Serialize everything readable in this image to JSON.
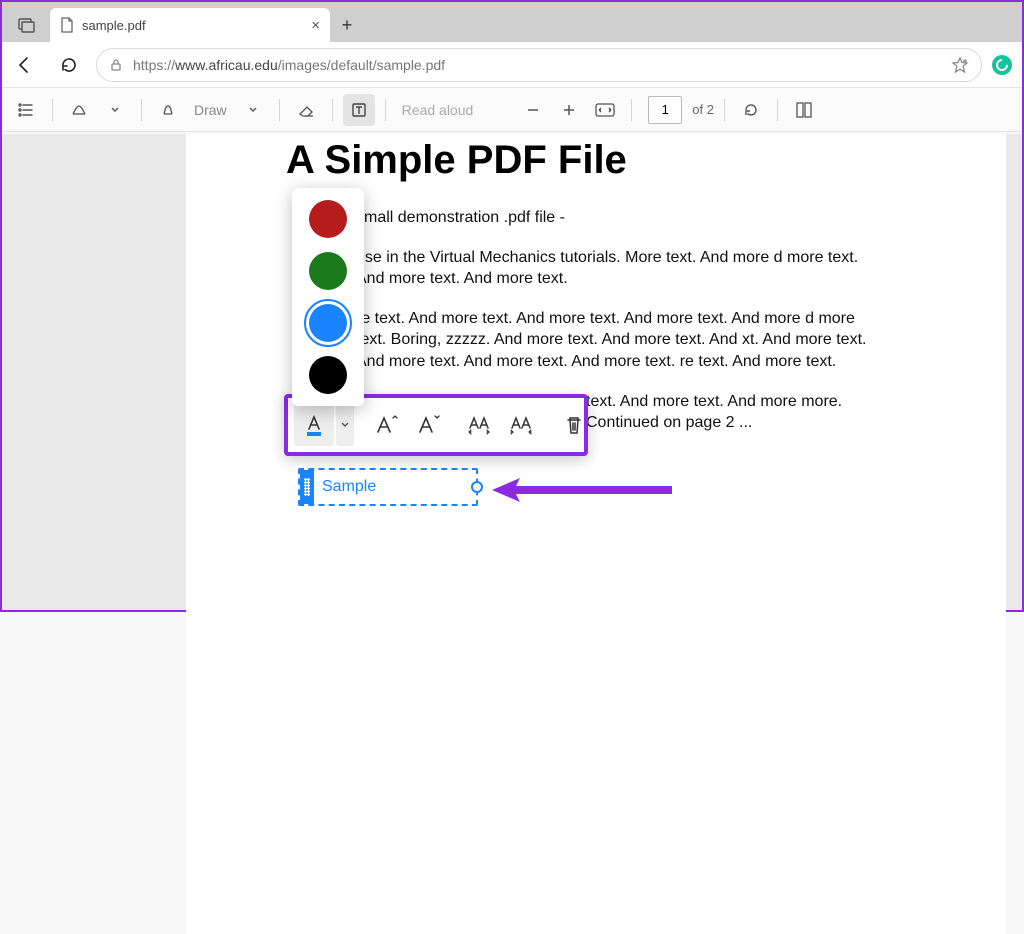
{
  "browser": {
    "tab_title": "sample.pdf",
    "url_display_prefix": "https://",
    "url_display_host": "www.africau.edu",
    "url_display_path": "/images/default/sample.pdf"
  },
  "pdf_toolbar": {
    "draw_label": "Draw",
    "read_aloud_label": "Read aloud",
    "page_current": "1",
    "page_total": "of 2"
  },
  "document": {
    "title": "A Simple PDF File",
    "p1": "small demonstration .pdf file -",
    "p2": "use in the Virtual Mechanics tutorials. More text. And more d more text. And more text. And more text.",
    "p3": "re text. And more text. And more text. And more text. And more d more text. Boring, zzzzz. And more text. And more text. And xt. And more text. And more text. And more text. And more text. re text. And more text.",
    "p4": "text. And more text. And more more. Continued on page 2 ..."
  },
  "color_picker": {
    "colors": [
      "#b71c1c",
      "#1b7a1b",
      "#1a84ff",
      "#000000"
    ],
    "selected_index": 2
  },
  "text_annotation": {
    "value": "Sample"
  }
}
